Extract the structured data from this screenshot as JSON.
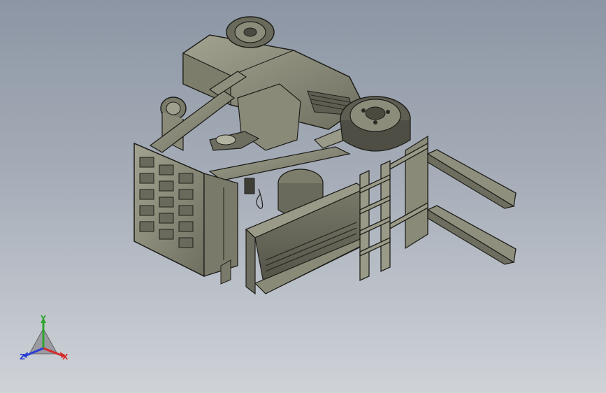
{
  "viewport": {
    "background_top": "#8c96a4",
    "background_bottom": "#cfd3d8",
    "model_fill": "#8a8a78",
    "model_edge": "#1e1e1a"
  },
  "model": {
    "subject": "forklift-cad-model",
    "parts": [
      "counterweight",
      "rear-wheel",
      "front-wheel",
      "overhead-guard",
      "mast",
      "fork-carriage",
      "fork-upper",
      "fork-lower",
      "engine",
      "seat-bracket"
    ]
  },
  "triad": {
    "y_label": "Y",
    "x_label": "X",
    "z_label": "Z",
    "y_color": "#2fa52f",
    "x_color": "#d22b2b",
    "z_color": "#2b3fd2"
  }
}
